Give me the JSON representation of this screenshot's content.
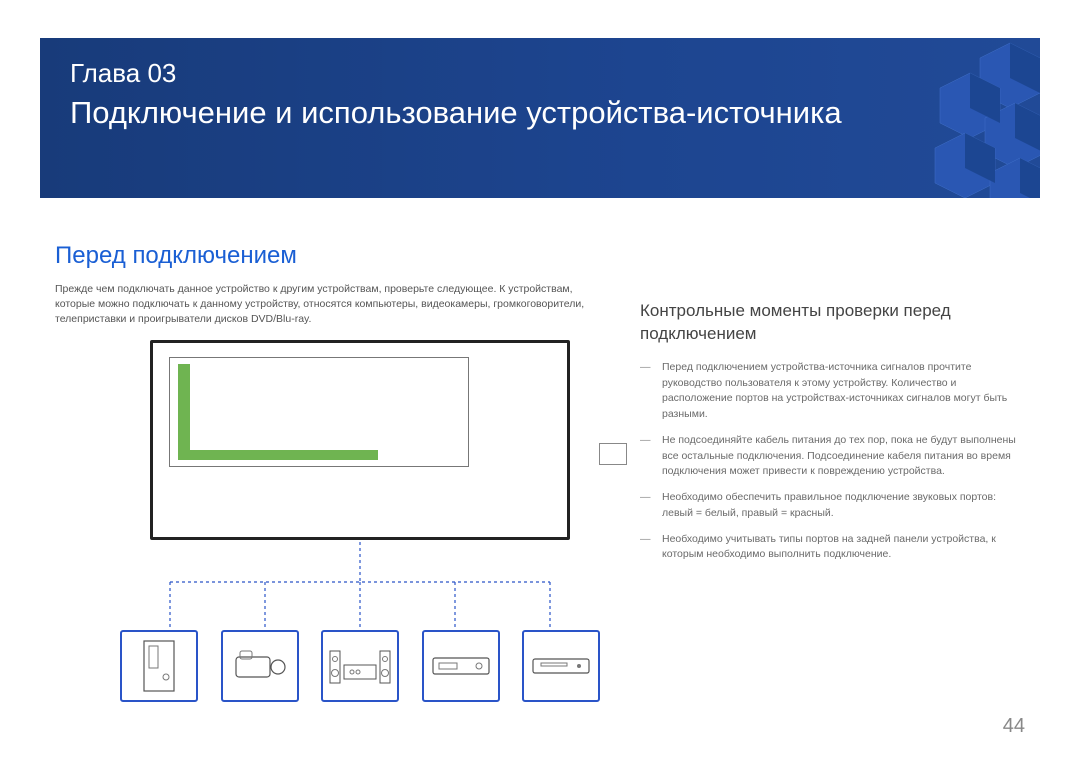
{
  "chapter_label": "Глава 03",
  "chapter_title": "Подключение и использование устройства-источника",
  "section_title": "Перед подключением",
  "intro_text": "Прежде чем подключать данное устройство к другим устройствам, проверьте следующее. К устройствам, которые можно подключать к данному устройству, относятся компьютеры, видеокамеры, громкоговорители, телеприставки и проигрыватели дисков DVD/Blu-ray.",
  "right": {
    "subhead": "Контрольные моменты проверки перед подключением",
    "bullets": [
      "Перед подключением устройства-источника сигналов прочтите руководство пользователя к этому устройству.\nКоличество и расположение портов на устройствах-источниках сигналов могут быть разными.",
      "Не подсоединяйте кабель питания до тех пор, пока не будут выполнены все остальные подключения.\nПодсоединение кабеля питания во время подключения может привести к повреждению устройства.",
      "Необходимо обеспечить правильное подключение звуковых портов: левый = белый, правый = красный.",
      "Необходимо учитывать типы портов на задней панели устройства, к которым необходимо выполнить подключение."
    ]
  },
  "page_number": "44",
  "devices": [
    "pc-tower-icon",
    "camcorder-icon",
    "speaker-system-icon",
    "settop-box-icon",
    "dvd-player-icon"
  ]
}
